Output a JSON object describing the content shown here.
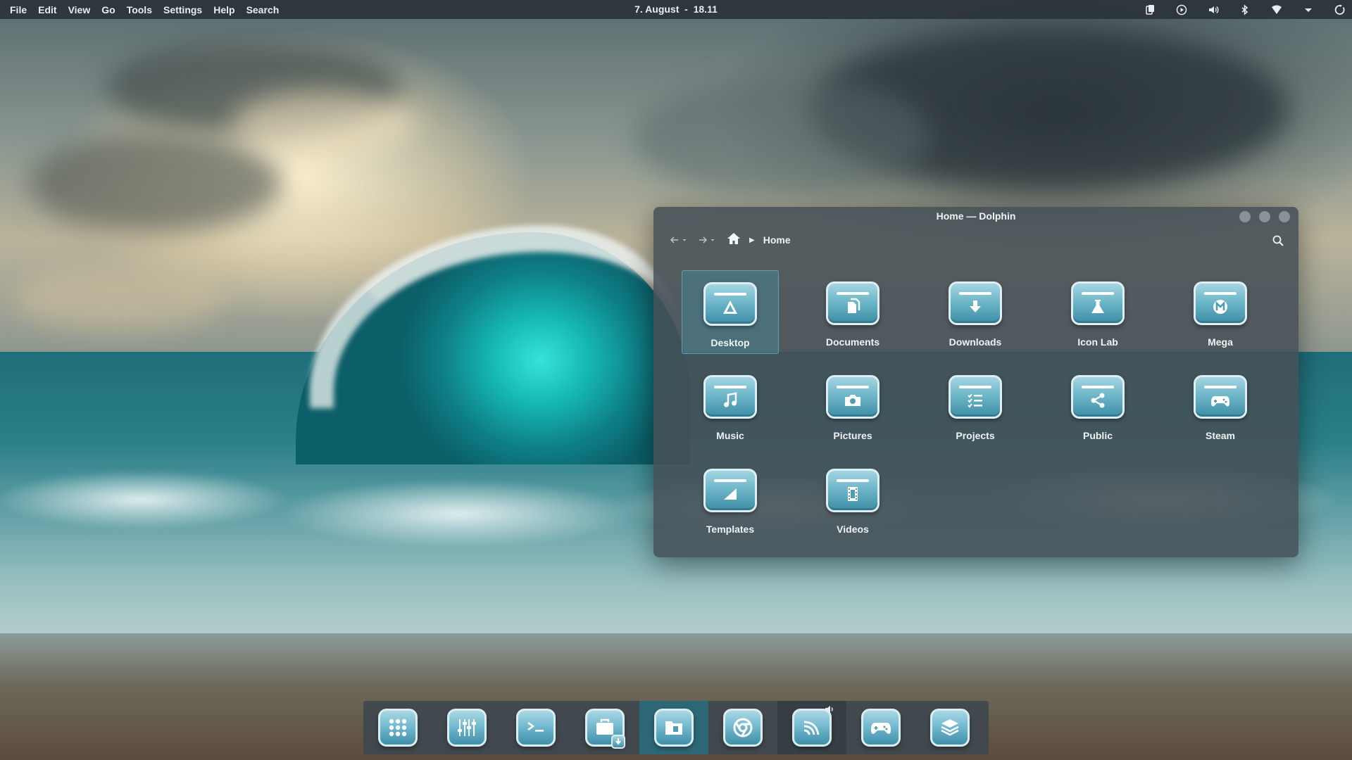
{
  "menubar": {
    "items": [
      {
        "name": "menu-file",
        "label": "File"
      },
      {
        "name": "menu-edit",
        "label": "Edit"
      },
      {
        "name": "menu-view",
        "label": "View"
      },
      {
        "name": "menu-go",
        "label": "Go"
      },
      {
        "name": "menu-tools",
        "label": "Tools"
      },
      {
        "name": "menu-settings",
        "label": "Settings"
      },
      {
        "name": "menu-help",
        "label": "Help"
      },
      {
        "name": "menu-search",
        "label": "Search"
      }
    ]
  },
  "clock": {
    "text": "7. August  -  18.11"
  },
  "tray": {
    "icons": [
      "clipboard-icon",
      "media-play-icon",
      "volume-icon",
      "bluetooth-icon",
      "network-wifi-icon",
      "chevron-down-icon",
      "power-icon"
    ]
  },
  "window": {
    "title": "Home — Dolphin",
    "breadcrumb": {
      "current": "Home"
    },
    "folders": [
      {
        "label": "Desktop",
        "icon": "desktop-icon",
        "selected": true
      },
      {
        "label": "Documents",
        "icon": "documents-icon"
      },
      {
        "label": "Downloads",
        "icon": "downloads-icon"
      },
      {
        "label": "Icon Lab",
        "icon": "flask-icon"
      },
      {
        "label": "Mega",
        "icon": "mega-icon"
      },
      {
        "label": "Music",
        "icon": "music-note-icon"
      },
      {
        "label": "Pictures",
        "icon": "camera-icon"
      },
      {
        "label": "Projects",
        "icon": "checklist-icon"
      },
      {
        "label": "Public",
        "icon": "share-icon"
      },
      {
        "label": "Steam",
        "icon": "gamepad-icon"
      },
      {
        "label": "Templates",
        "icon": "template-icon"
      },
      {
        "label": "Videos",
        "icon": "film-icon"
      }
    ]
  },
  "dock": {
    "items": [
      {
        "icon": "app-grid-icon"
      },
      {
        "icon": "mixer-sliders-icon"
      },
      {
        "icon": "terminal-icon"
      },
      {
        "icon": "briefcase-download-icon"
      },
      {
        "icon": "folder-files-icon",
        "state": "active"
      },
      {
        "icon": "chrome-browser-icon"
      },
      {
        "icon": "podcast-feed-icon",
        "state": "running"
      },
      {
        "icon": "gamepad-icon"
      },
      {
        "icon": "layers-stack-icon"
      }
    ]
  },
  "colors": {
    "topbar": "#2c3439",
    "window_bg": "#465056",
    "accent": "#6fb7c9",
    "selection": "#468ca0",
    "dock_active": "#286e80"
  }
}
